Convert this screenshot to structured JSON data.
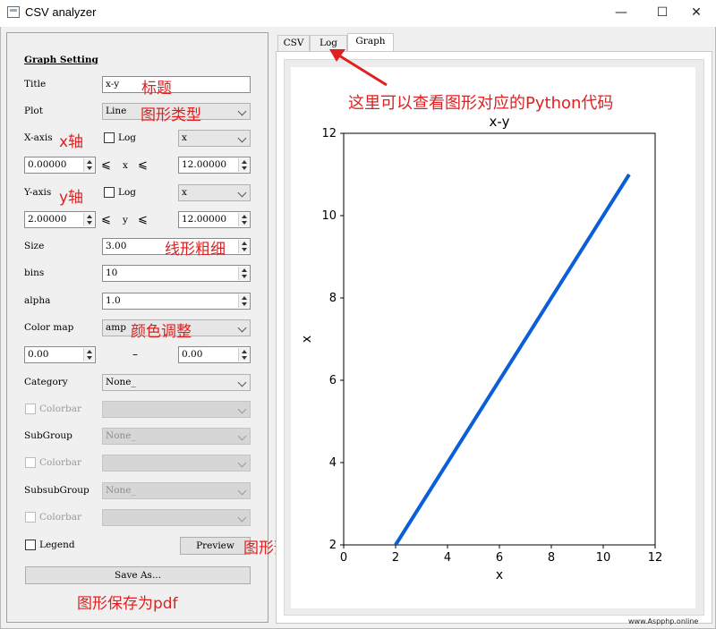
{
  "window": {
    "title": "CSV analyzer",
    "minimize_glyph": "—",
    "maximize_glyph": "☐",
    "close_glyph": "✕"
  },
  "panel": {
    "heading": "Graph Setting",
    "title_label": "Title",
    "title_value": "x-y",
    "plot_label": "Plot",
    "plot_value": "Line",
    "xaxis_label": "X-axis",
    "xaxis_log_label": "Log",
    "xaxis_column": "x",
    "xmin": "0.00000",
    "xmax": "12.00000",
    "x_symbol": "x",
    "yaxis_label": "Y-axis",
    "yaxis_log_label": "Log",
    "yaxis_column": "x",
    "ymin": "2.00000",
    "ymax": "12.00000",
    "y_symbol": "y",
    "leq": "⩽",
    "size_label": "Size",
    "size_value": "3.00",
    "bins_label": "bins",
    "bins_value": "10",
    "alpha_label": "alpha",
    "alpha_value": "1.0",
    "colormap_label": "Color map",
    "colormap_value": "amp",
    "cmap_min": "0.00",
    "cmap_dash": "–",
    "cmap_max": "0.00",
    "category_label": "Category",
    "category_value": "None_",
    "colorbar_label": "Colorbar",
    "subgroup_label": "SubGroup",
    "subgroup_value": "None_",
    "subsubgroup_label": "SubsubGroup",
    "subsubgroup_value": "None_",
    "legend_label": "Legend",
    "preview_label": "Preview",
    "save_label": "Save As..."
  },
  "tabs": [
    {
      "label": "CSV",
      "active": false
    },
    {
      "label": "Log",
      "active": false
    },
    {
      "label": "Graph",
      "active": true
    }
  ],
  "annotations": {
    "title": "标题",
    "plot_type": "图形类型",
    "x_axis": "x轴",
    "y_axis": "y轴",
    "line_width": "线形粗细",
    "color": "颜色调整",
    "preview": "图形预览",
    "save_pdf": "图形保存为pdf",
    "log_tab": "这里可以查看图形对应的Python代码",
    "color_hex": "#e02020"
  },
  "chart_data": {
    "type": "line",
    "title": "x-y",
    "xlabel": "x",
    "ylabel": "x",
    "xlim": [
      0,
      12
    ],
    "ylim": [
      2,
      12
    ],
    "xticks": [
      0,
      2,
      4,
      6,
      8,
      10,
      12
    ],
    "yticks": [
      2,
      4,
      6,
      8,
      10,
      12
    ],
    "series": [
      {
        "x": [
          2,
          11
        ],
        "y": [
          2,
          11
        ],
        "color": "#0a5fd8"
      }
    ],
    "grid": false
  },
  "watermark": "www.Aspphp.online"
}
